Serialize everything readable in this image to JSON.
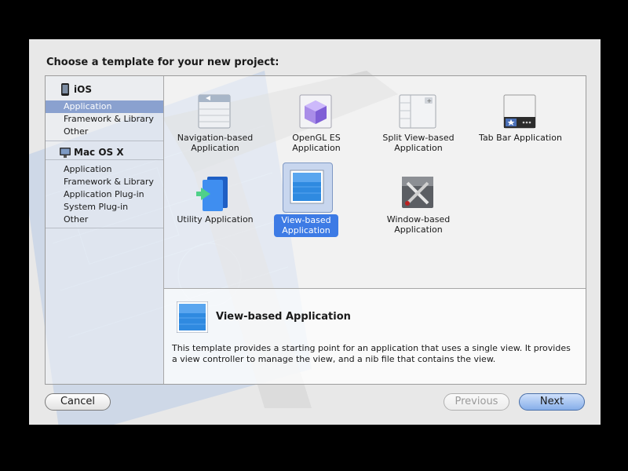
{
  "dialog": {
    "title": "Choose a template for your new project:"
  },
  "sidebar": {
    "sections": [
      {
        "name": "iOS",
        "icon": "iphone-icon",
        "items": [
          "Application",
          "Framework & Library",
          "Other"
        ],
        "selected": "Application"
      },
      {
        "name": "Mac OS X",
        "icon": "mac-icon",
        "items": [
          "Application",
          "Framework & Library",
          "Application Plug-in",
          "System Plug-in",
          "Other"
        ]
      }
    ]
  },
  "templates": [
    {
      "line1": "Navigation-based",
      "line2": "Application",
      "icon": "navigation-template-icon"
    },
    {
      "line1": "OpenGL ES",
      "line2": "Application",
      "icon": "opengl-cube-icon"
    },
    {
      "line1": "Split View-based",
      "line2": "Application",
      "icon": "split-view-icon"
    },
    {
      "line1": "Tab Bar Application",
      "line2": "",
      "icon": "tab-bar-icon"
    },
    {
      "line1": "Utility Application",
      "line2": "",
      "icon": "utility-flip-icon"
    },
    {
      "line1": "View-based",
      "line2": "Application",
      "icon": "view-based-icon",
      "selected": true
    },
    {
      "line1": "Window-based",
      "line2": "Application",
      "icon": "window-based-tools-icon"
    }
  ],
  "description": {
    "name": "View-based Application",
    "text": "This template provides a starting point for an application that uses a single view. It provides a view controller to manage the view, and a nib file that contains the view."
  },
  "buttons": {
    "cancel": "Cancel",
    "previous": "Previous",
    "next": "Next"
  },
  "colors": {
    "selection": "#3d7be5",
    "sidebar_selected": "#8aa1cf",
    "next_button": "#86aee9"
  }
}
